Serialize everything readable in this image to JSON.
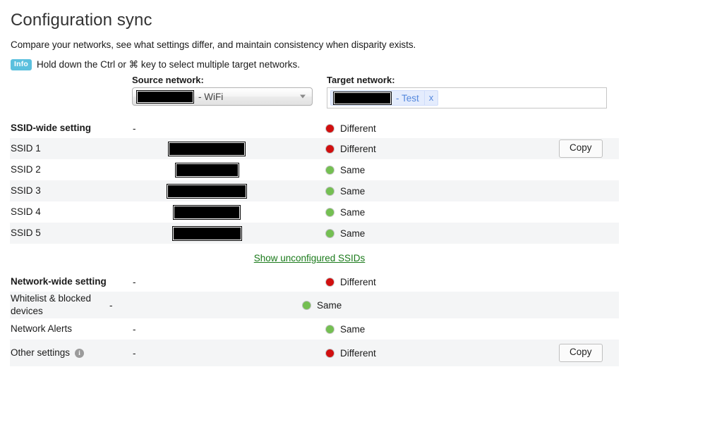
{
  "header": {
    "title": "Configuration sync",
    "subtitle": "Compare your networks, see what settings differ, and maintain consistency when disparity exists.",
    "info_badge": "Info",
    "info_text": "Hold down the Ctrl or ⌘ key to select multiple target networks."
  },
  "selectors": {
    "source": {
      "label": "Source network:",
      "value_suffix": "- WiFi",
      "icon": "chevron-down-icon"
    },
    "target": {
      "label": "Target network:",
      "token_suffix": "- Test",
      "remove_label": "x"
    }
  },
  "colors": {
    "different": "#d10f0f",
    "same": "#74bf52",
    "link": "#1a7a1a",
    "info_badge": "#5bc0de",
    "token": "#5588dd"
  },
  "table": {
    "status_labels": {
      "different": "Different",
      "same": "Same"
    },
    "copy_label": "Copy",
    "source_empty": "-",
    "sections": [
      {
        "heading": "SSID-wide setting",
        "heading_source": "-",
        "heading_status": "Different",
        "heading_state": "different",
        "rows": [
          {
            "name": "SSID 1",
            "source": "",
            "redact_width": 106,
            "status": "Different",
            "state": "different",
            "action": "Copy"
          },
          {
            "name": "SSID 2",
            "source": "",
            "redact_width": 87,
            "status": "Same",
            "state": "same",
            "action": ""
          },
          {
            "name": "SSID 3",
            "source": "",
            "redact_width": 110,
            "status": "Same",
            "state": "same",
            "action": ""
          },
          {
            "name": "SSID 4",
            "source": "",
            "redact_width": 92,
            "status": "Same",
            "state": "same",
            "action": ""
          },
          {
            "name": "SSID 5",
            "source": "",
            "redact_width": 95,
            "status": "Same",
            "state": "same",
            "action": ""
          }
        ]
      },
      {
        "heading": "Network-wide setting",
        "heading_source": "-",
        "heading_status": "Different",
        "heading_state": "different",
        "rows": [
          {
            "name": "Whitelist & blocked devices",
            "source": "-",
            "status": "Same",
            "state": "same",
            "action": ""
          },
          {
            "name": "Network Alerts",
            "source": "-",
            "status": "Same",
            "state": "same",
            "action": ""
          },
          {
            "name": "Other settings",
            "source": "-",
            "status": "Different",
            "state": "different",
            "action": "Copy",
            "info_icon": "info-circle-icon"
          }
        ]
      }
    ]
  },
  "links": {
    "show_unconfigured": "Show unconfigured SSIDs"
  }
}
